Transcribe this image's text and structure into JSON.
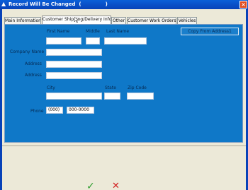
{
  "window": {
    "title": "Record Will Be Changed  (              )"
  },
  "tabs": [
    {
      "label": "Main Information"
    },
    {
      "label": "Customer Shipping/Delivery Info"
    },
    {
      "label": "Other"
    },
    {
      "label": "Customer Work Orders"
    },
    {
      "label": "Vehicles"
    }
  ],
  "form": {
    "first_name_label": "First Name",
    "middle_label": "Middle",
    "last_name_label": "Last Name",
    "copy_button_label": "Copy From Address1",
    "company_name_label": "Company Name",
    "address_label": "Address",
    "address2_label": "Address",
    "city_label": "City",
    "state_label": "State",
    "zip_label": "Zip Code",
    "phone_label": "Phone",
    "phone_area_value": "(000)",
    "phone_number_value": "000-0000"
  },
  "icons": {
    "ok": "check-icon",
    "cancel": "x-icon"
  }
}
